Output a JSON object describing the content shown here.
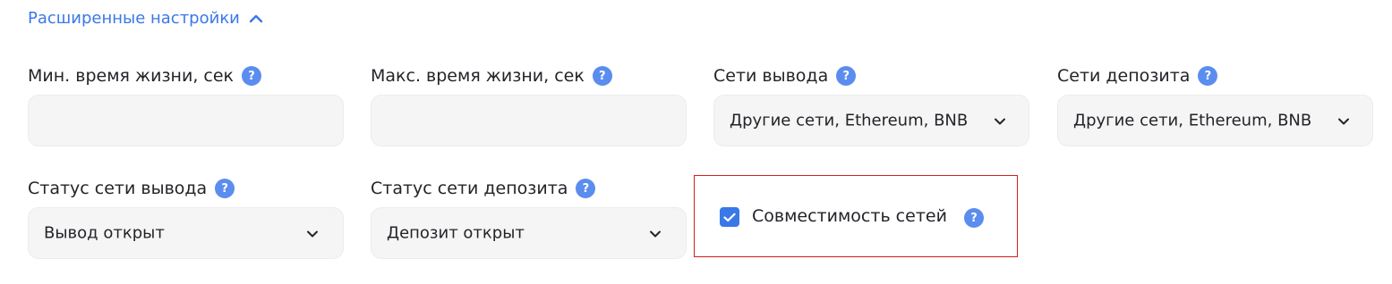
{
  "advanced": {
    "title": "Расширенные настройки"
  },
  "fields": {
    "min_lifetime": {
      "label": "Мин. время жизни, сек",
      "value": ""
    },
    "max_lifetime": {
      "label": "Макс. время жизни, сек",
      "value": ""
    },
    "withdraw_networks": {
      "label": "Сети вывода",
      "value": "Другие сети, Ethereum, BNB"
    },
    "deposit_networks": {
      "label": "Сети депозита",
      "value": "Другие сети, Ethereum, BNB"
    },
    "withdraw_status": {
      "label": "Статус сети вывода",
      "value": "Вывод открыт"
    },
    "deposit_status": {
      "label": "Статус сети депозита",
      "value": "Депозит открыт"
    }
  },
  "compatibility": {
    "label": "Совместимость сетей",
    "checked": true
  },
  "help_glyph": "?",
  "icons": {
    "help": "question-circle-icon",
    "chevron": "chevron-down-icon",
    "collapse": "chevron-up-icon",
    "check": "checkmark-icon"
  },
  "colors": {
    "accent": "#3a78e8",
    "help_badge": "#5b8def",
    "field_bg": "#f5f5f5",
    "highlight_border": "#d71e1e",
    "text": "#222428"
  }
}
